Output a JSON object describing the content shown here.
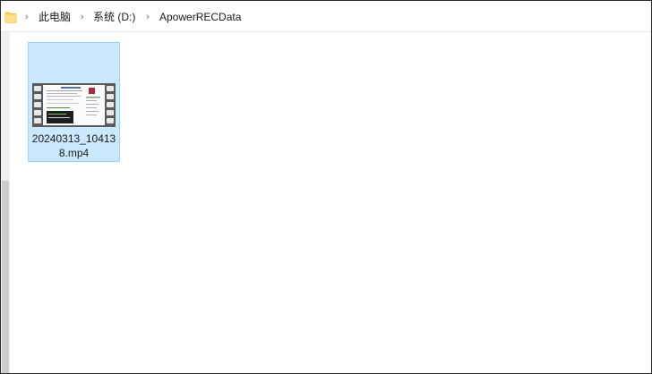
{
  "breadcrumb": {
    "items": [
      "此电脑",
      "系统 (D:)",
      "ApowerRECData"
    ],
    "separator": "›"
  },
  "icons": {
    "folder": "folder-icon",
    "video_file": "video-file-icon"
  },
  "files": [
    {
      "name": "20240313_104138.mp4",
      "selected": true
    }
  ],
  "colors": {
    "selection_bg": "#cce8ff",
    "selection_border": "#99d1ff",
    "folder": "#ffd55a"
  }
}
